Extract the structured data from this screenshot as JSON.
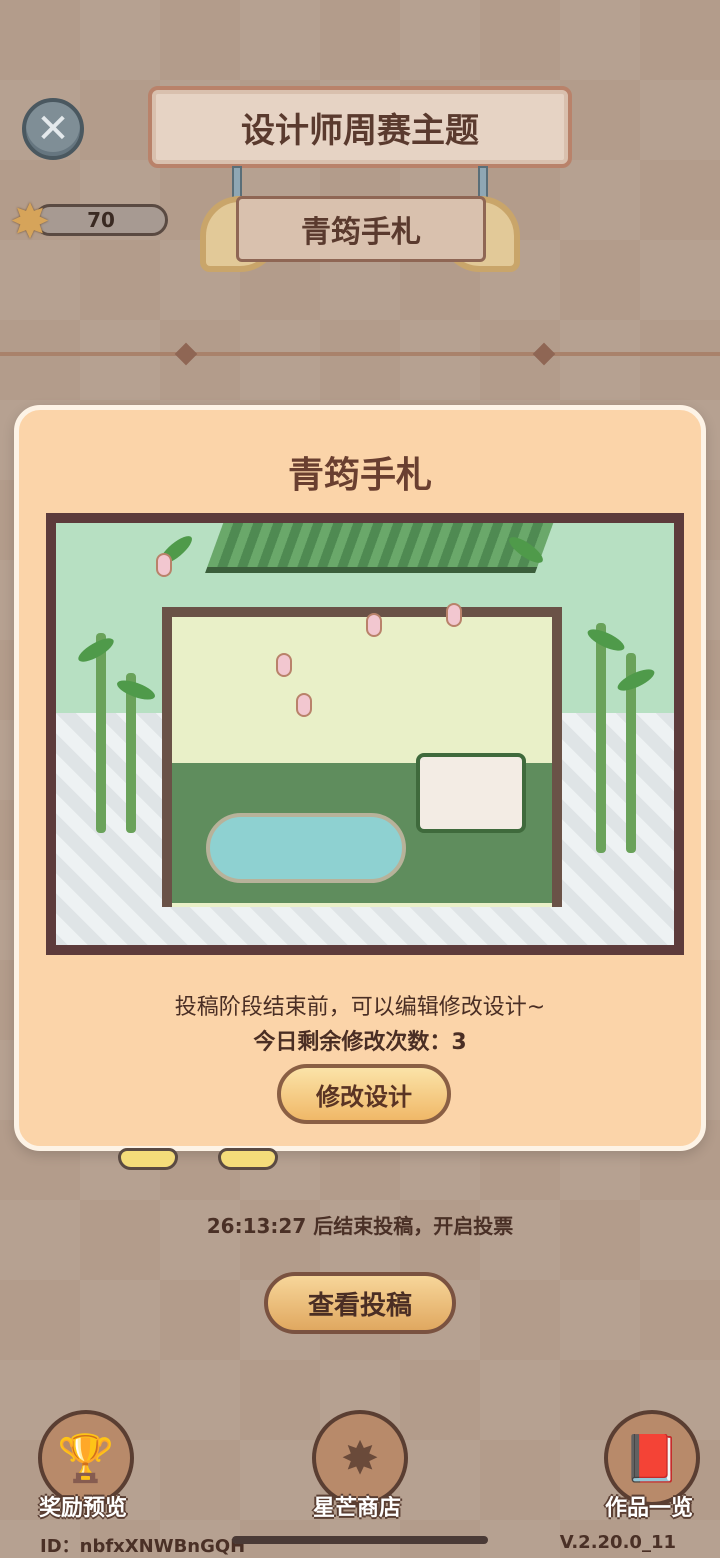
{
  "header": {
    "title": "设计师周赛主题",
    "theme_name": "青筠手札",
    "star_count": "70"
  },
  "modal": {
    "title": "青筠手札",
    "line1": "投稿阶段结束前，可以编辑修改设计~",
    "line2": "今日剩余修改次数：3",
    "edit_button": "修改设计"
  },
  "status": {
    "countdown": "26:13:27 后结束投稿，开启投票"
  },
  "actions": {
    "view_submissions": "查看投稿"
  },
  "bottom_nav": [
    {
      "label": "奖励预览",
      "icon": "trophy-icon"
    },
    {
      "label": "星芒商店",
      "icon": "star-icon"
    },
    {
      "label": "作品一览",
      "icon": "book-icon"
    }
  ],
  "footer": {
    "id": "ID：nbfxXNWBnGQH",
    "version": "V.2.20.0_11"
  },
  "colors": {
    "modal_bg": "#fbd4a9",
    "button_bg": "#f0b868",
    "frame": "#5d3b3b"
  }
}
